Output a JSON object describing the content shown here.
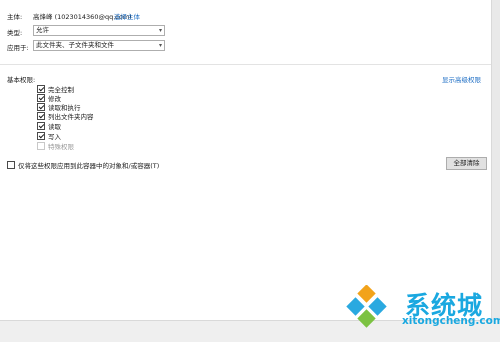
{
  "principal": {
    "label": "主体:",
    "value": "高烽峰 (1023014360@qq.com)",
    "link": "选择主体"
  },
  "type_row": {
    "label": "类型:",
    "value": "允许"
  },
  "applies_row": {
    "label": "应用于:",
    "value": "此文件夹、子文件夹和文件"
  },
  "basic_permissions": {
    "title": "基本权限:",
    "advanced_link": "显示高级权限",
    "items": [
      {
        "label": "完全控制",
        "checked": true,
        "disabled": false
      },
      {
        "label": "修改",
        "checked": true,
        "disabled": false
      },
      {
        "label": "读取和执行",
        "checked": true,
        "disabled": false
      },
      {
        "label": "列出文件夹内容",
        "checked": true,
        "disabled": false
      },
      {
        "label": "读取",
        "checked": true,
        "disabled": false
      },
      {
        "label": "写入",
        "checked": true,
        "disabled": false
      },
      {
        "label": "特殊权限",
        "checked": false,
        "disabled": true
      }
    ]
  },
  "apply_only": {
    "label": "仅将这些权限应用到此容器中的对象和/或容器(T)",
    "checked": false
  },
  "clear_all_button": "全部清除",
  "watermark": {
    "brand": "系统城",
    "url": "xitongcheng.com"
  },
  "colors": {
    "link": "#1f6fc5",
    "brand": "#1aa8e0"
  }
}
